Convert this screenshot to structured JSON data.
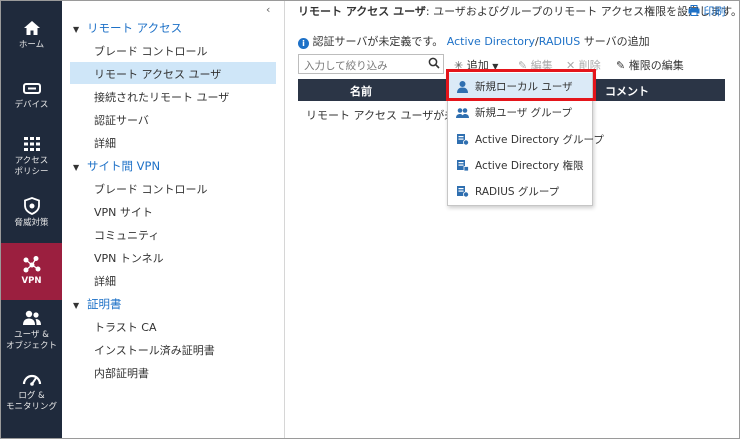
{
  "rail": {
    "items": [
      {
        "label": "ホーム",
        "icon": "home-icon"
      },
      {
        "label": "デバイス",
        "icon": "device-icon"
      },
      {
        "label": "アクセス\nポリシー",
        "icon": "access-policy-icon"
      },
      {
        "label": "脅威対策",
        "icon": "threat-shield-icon"
      },
      {
        "label": "VPN",
        "icon": "vpn-icon",
        "active": true
      },
      {
        "label": "ユーザ &\nオブジェクト",
        "icon": "users-icon"
      },
      {
        "label": "ログ &\nモニタリング",
        "icon": "gauge-icon"
      }
    ]
  },
  "tree": {
    "collapse": "‹",
    "sections": [
      {
        "label": "リモート アクセス",
        "items": [
          "ブレード コントロール",
          "リモート アクセス ユーザ",
          "接続されたリモート ユーザ",
          "認証サーバ",
          "詳細"
        ]
      },
      {
        "label": "サイト間 VPN",
        "items": [
          "ブレード コントロール",
          "VPN サイト",
          "コミュニティ",
          "VPN トンネル",
          "詳細"
        ]
      },
      {
        "label": "証明書",
        "items": [
          "トラスト CA",
          "インストール済み証明書",
          "内部証明書"
        ]
      }
    ],
    "selected": "リモート アクセス ユーザ"
  },
  "content": {
    "title_bold": "リモート アクセス ユーザ",
    "title_rest": ": ユーザおよびグループのリモート アクセス権限を設定します。",
    "print": "印刷",
    "info_text": "認証サーバが未定義です。",
    "info_link1": "Active Directory",
    "info_sep": "/",
    "info_link2": "RADIUS",
    "info_tail": " サーバの追加",
    "search_placeholder": "入力して絞り込み",
    "toolbar": {
      "add": "追加",
      "edit": "編集",
      "delete": "削除",
      "perm": "権限の編集"
    },
    "columns": [
      "名前",
      "コメント"
    ],
    "row_text": "リモート アクセス ユーザが未設"
  },
  "menu": {
    "items": [
      {
        "label": "新規ローカル ユーザ",
        "icon": "user-icon"
      },
      {
        "label": "新規ユーザ グループ",
        "icon": "user-group-icon"
      },
      {
        "label": "Active Directory グループ",
        "icon": "ad-group-icon"
      },
      {
        "label": "Active Directory 権限",
        "icon": "ad-permission-icon"
      },
      {
        "label": "RADIUS グループ",
        "icon": "radius-group-icon"
      }
    ]
  },
  "colors": {
    "rail": "#1f2a3c",
    "active": "#9b1f3f",
    "link": "#1e71c7",
    "highlight": "#e4151b"
  }
}
